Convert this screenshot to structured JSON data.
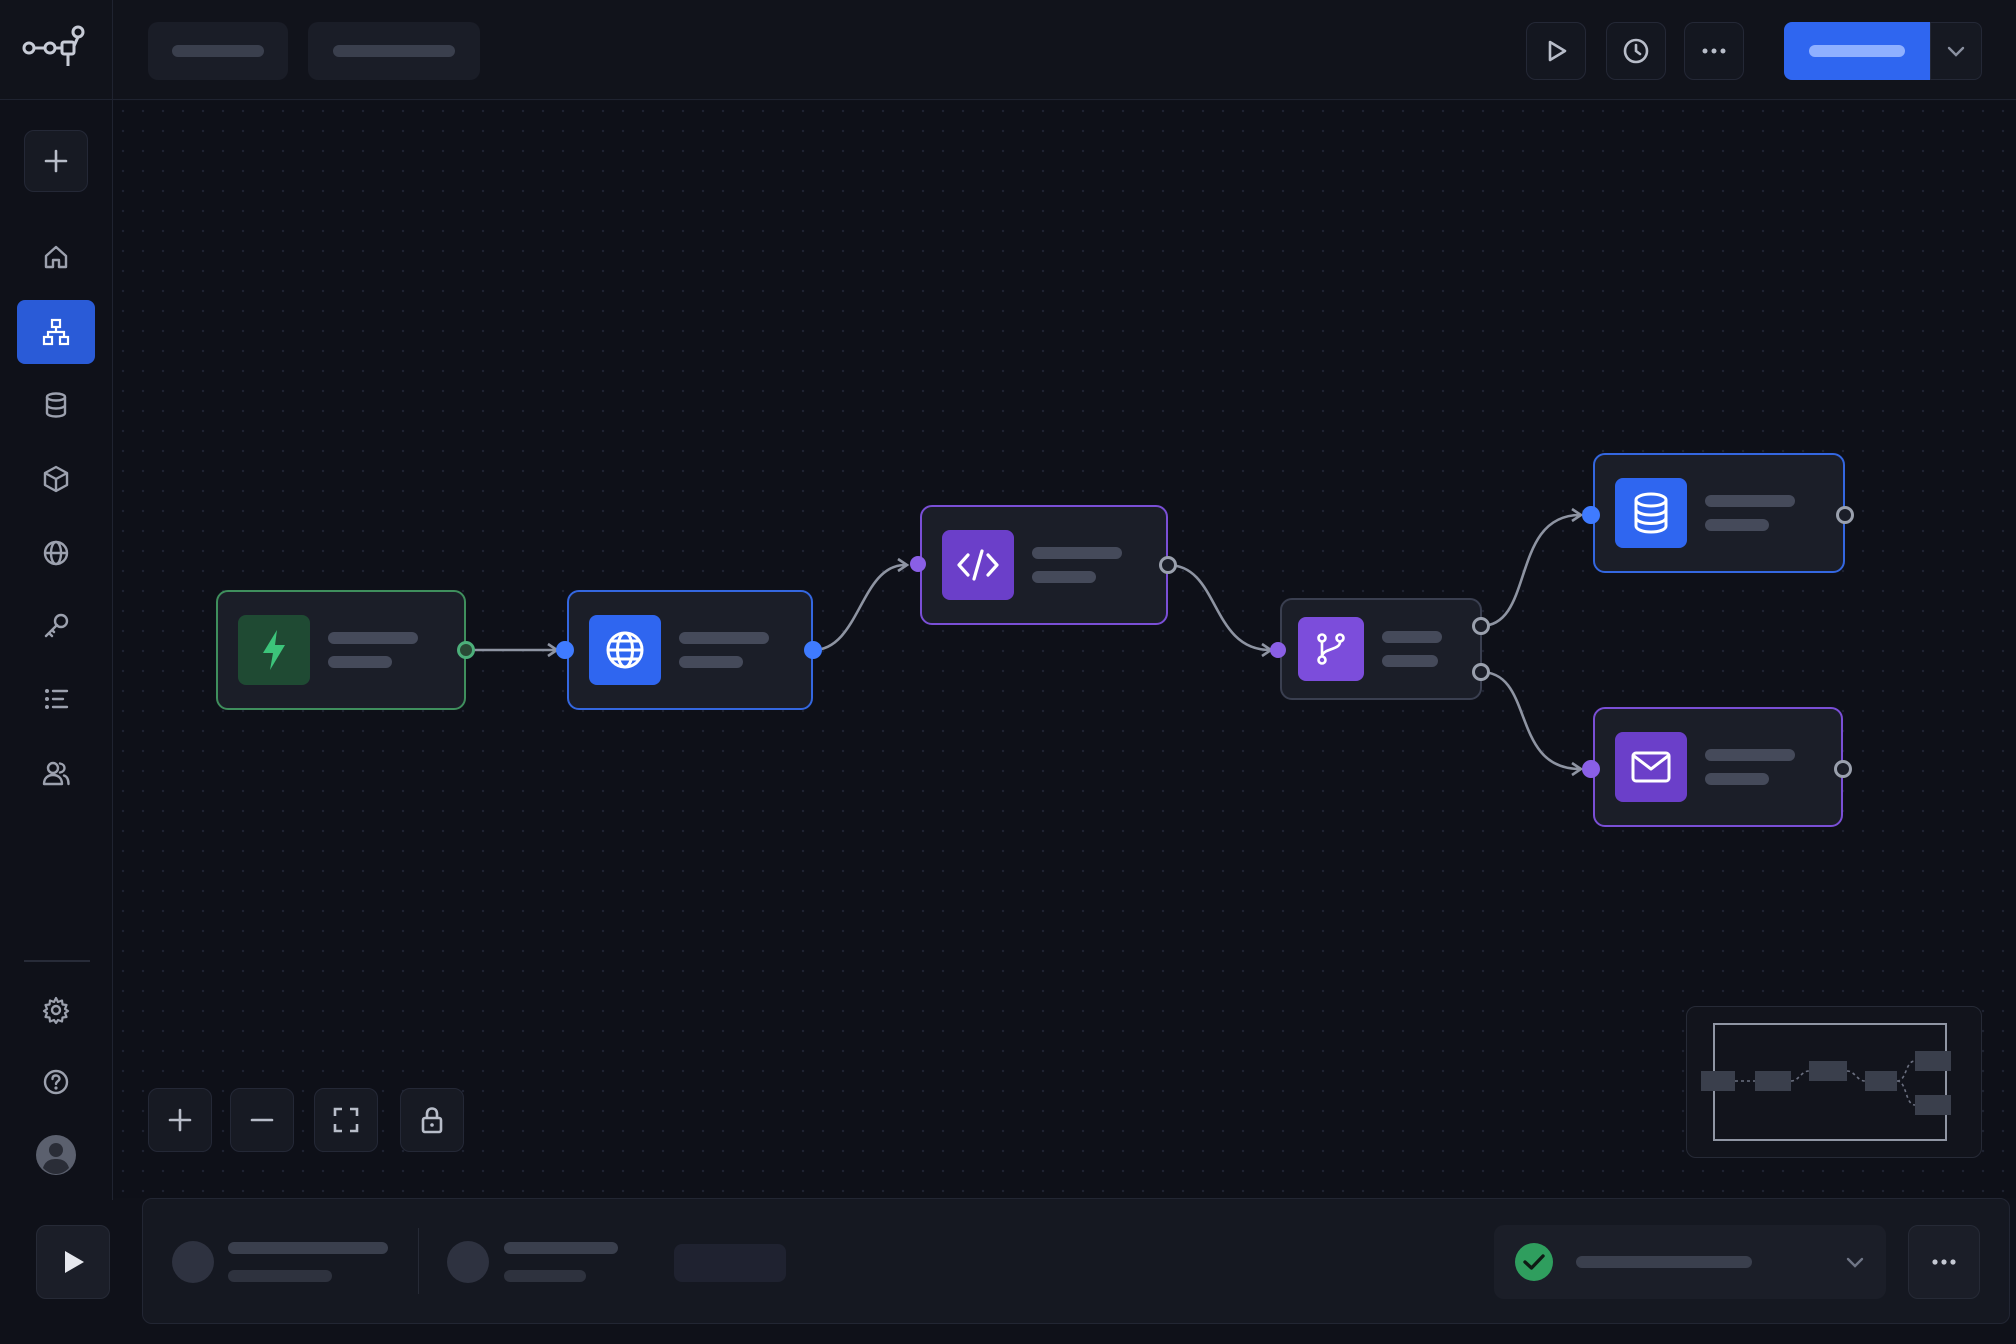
{
  "app": {
    "logo_icon": "workflow-logo-icon"
  },
  "toolbar": {
    "tabs": [
      {
        "name": "tab-placeholder-1"
      },
      {
        "name": "tab-placeholder-2"
      }
    ],
    "actions": [
      {
        "icon": "play-icon"
      },
      {
        "icon": "history-clock-icon"
      },
      {
        "icon": "more-horizontal-icon"
      }
    ],
    "primary_caret_icon": "chevron-down-icon",
    "accent_color": "#2f66f0"
  },
  "sidebar": {
    "add_icon": "plus-icon",
    "items": [
      {
        "icon": "home-icon",
        "active": false
      },
      {
        "icon": "workflow-tree-icon",
        "active": true
      },
      {
        "icon": "database-icon",
        "active": false
      },
      {
        "icon": "package-cube-icon",
        "active": false
      },
      {
        "icon": "globe-icon",
        "active": false
      },
      {
        "icon": "key-icon",
        "active": false
      },
      {
        "icon": "list-icon",
        "active": false
      },
      {
        "icon": "users-icon",
        "active": false
      }
    ],
    "bottom_items": [
      {
        "icon": "settings-gear-icon"
      },
      {
        "icon": "help-circle-icon"
      },
      {
        "icon": "user-avatar-icon"
      }
    ]
  },
  "canvas": {
    "nodes": [
      {
        "id": "trigger",
        "icon": "lightning-bolt-icon",
        "color": "#2f9e5e"
      },
      {
        "id": "http",
        "icon": "globe-icon",
        "color": "#2f66f0"
      },
      {
        "id": "code",
        "icon": "code-brackets-icon",
        "color": "#6b3fc9"
      },
      {
        "id": "branch",
        "icon": "git-branch-icon",
        "color": "#7c4ddb"
      },
      {
        "id": "database",
        "icon": "database-icon",
        "color": "#2f66f0"
      },
      {
        "id": "email",
        "icon": "mail-envelope-icon",
        "color": "#7c4ddb"
      }
    ],
    "controls": [
      {
        "icon": "zoom-in-plus-icon"
      },
      {
        "icon": "zoom-out-minus-icon"
      },
      {
        "icon": "fit-view-icon"
      },
      {
        "icon": "lock-icon"
      }
    ]
  },
  "bottom_bar": {
    "run_icon": "play-icon",
    "status_icon": "check-circle-icon",
    "status_color": "#2f9e5e",
    "status_caret_icon": "chevron-down-icon",
    "more_icon": "more-horizontal-icon"
  }
}
